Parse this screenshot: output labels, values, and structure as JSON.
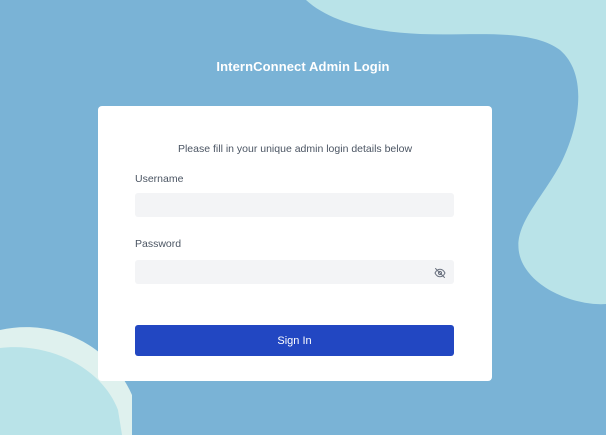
{
  "header": {
    "title": "InternConnect Admin Login"
  },
  "login_form": {
    "instructions": "Please fill in your unique admin login details below",
    "username": {
      "label": "Username",
      "value": "",
      "placeholder": ""
    },
    "password": {
      "label": "Password",
      "value": "",
      "placeholder": "",
      "toggle_icon": "eye-off-icon"
    },
    "submit_label": "Sign In"
  },
  "colors": {
    "background": "#7ab3d6",
    "blob_light": "#b9e3e8",
    "blob_pale": "#dff1ee",
    "card": "#ffffff",
    "input_fill": "#f3f4f6",
    "primary_button": "#2247c2"
  }
}
